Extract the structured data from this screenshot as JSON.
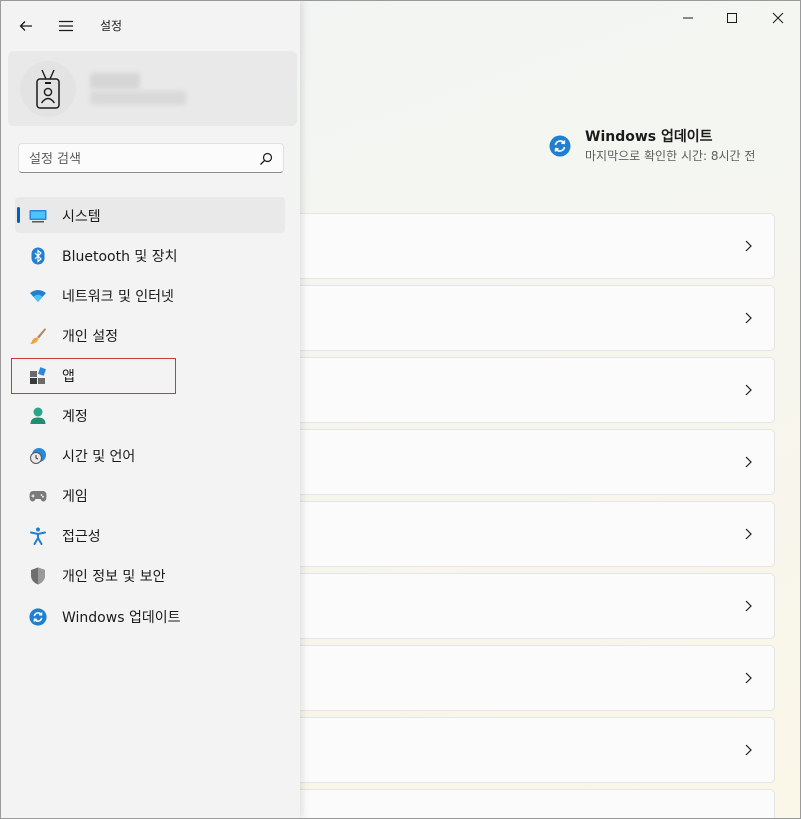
{
  "window": {
    "title": "설정",
    "controls": [
      "minimize-icon",
      "maximize-icon",
      "close-icon"
    ]
  },
  "nav": {
    "back_icon": "back-arrow-icon",
    "menu_icon": "hamburger-menu-icon"
  },
  "search": {
    "placeholder": "설정 검색",
    "icon": "search-icon"
  },
  "sidebar": {
    "items": [
      {
        "label": "시스템",
        "icon": "system-display-icon",
        "selected": true
      },
      {
        "label": "Bluetooth 및 장치",
        "icon": "bluetooth-icon"
      },
      {
        "label": "네트워크 및 인터넷",
        "icon": "wifi-icon"
      },
      {
        "label": "개인 설정",
        "icon": "brush-icon"
      },
      {
        "label": "앱",
        "icon": "apps-icon"
      },
      {
        "label": "계정",
        "icon": "account-icon"
      },
      {
        "label": "시간 및 언어",
        "icon": "time-language-icon"
      },
      {
        "label": "게임",
        "icon": "gamepad-icon"
      },
      {
        "label": "접근성",
        "icon": "accessibility-icon"
      },
      {
        "label": "개인 정보 및 보안",
        "icon": "shield-icon"
      },
      {
        "label": "Windows 업데이트",
        "icon": "windows-update-icon"
      }
    ]
  },
  "update": {
    "title": "Windows 업데이트",
    "subtitle": "마지막으로 확인한 시간: 8시간 전",
    "icon": "windows-update-icon"
  },
  "colors": {
    "accent": "#005fb8",
    "highlight_border": "#cc3b3b"
  }
}
